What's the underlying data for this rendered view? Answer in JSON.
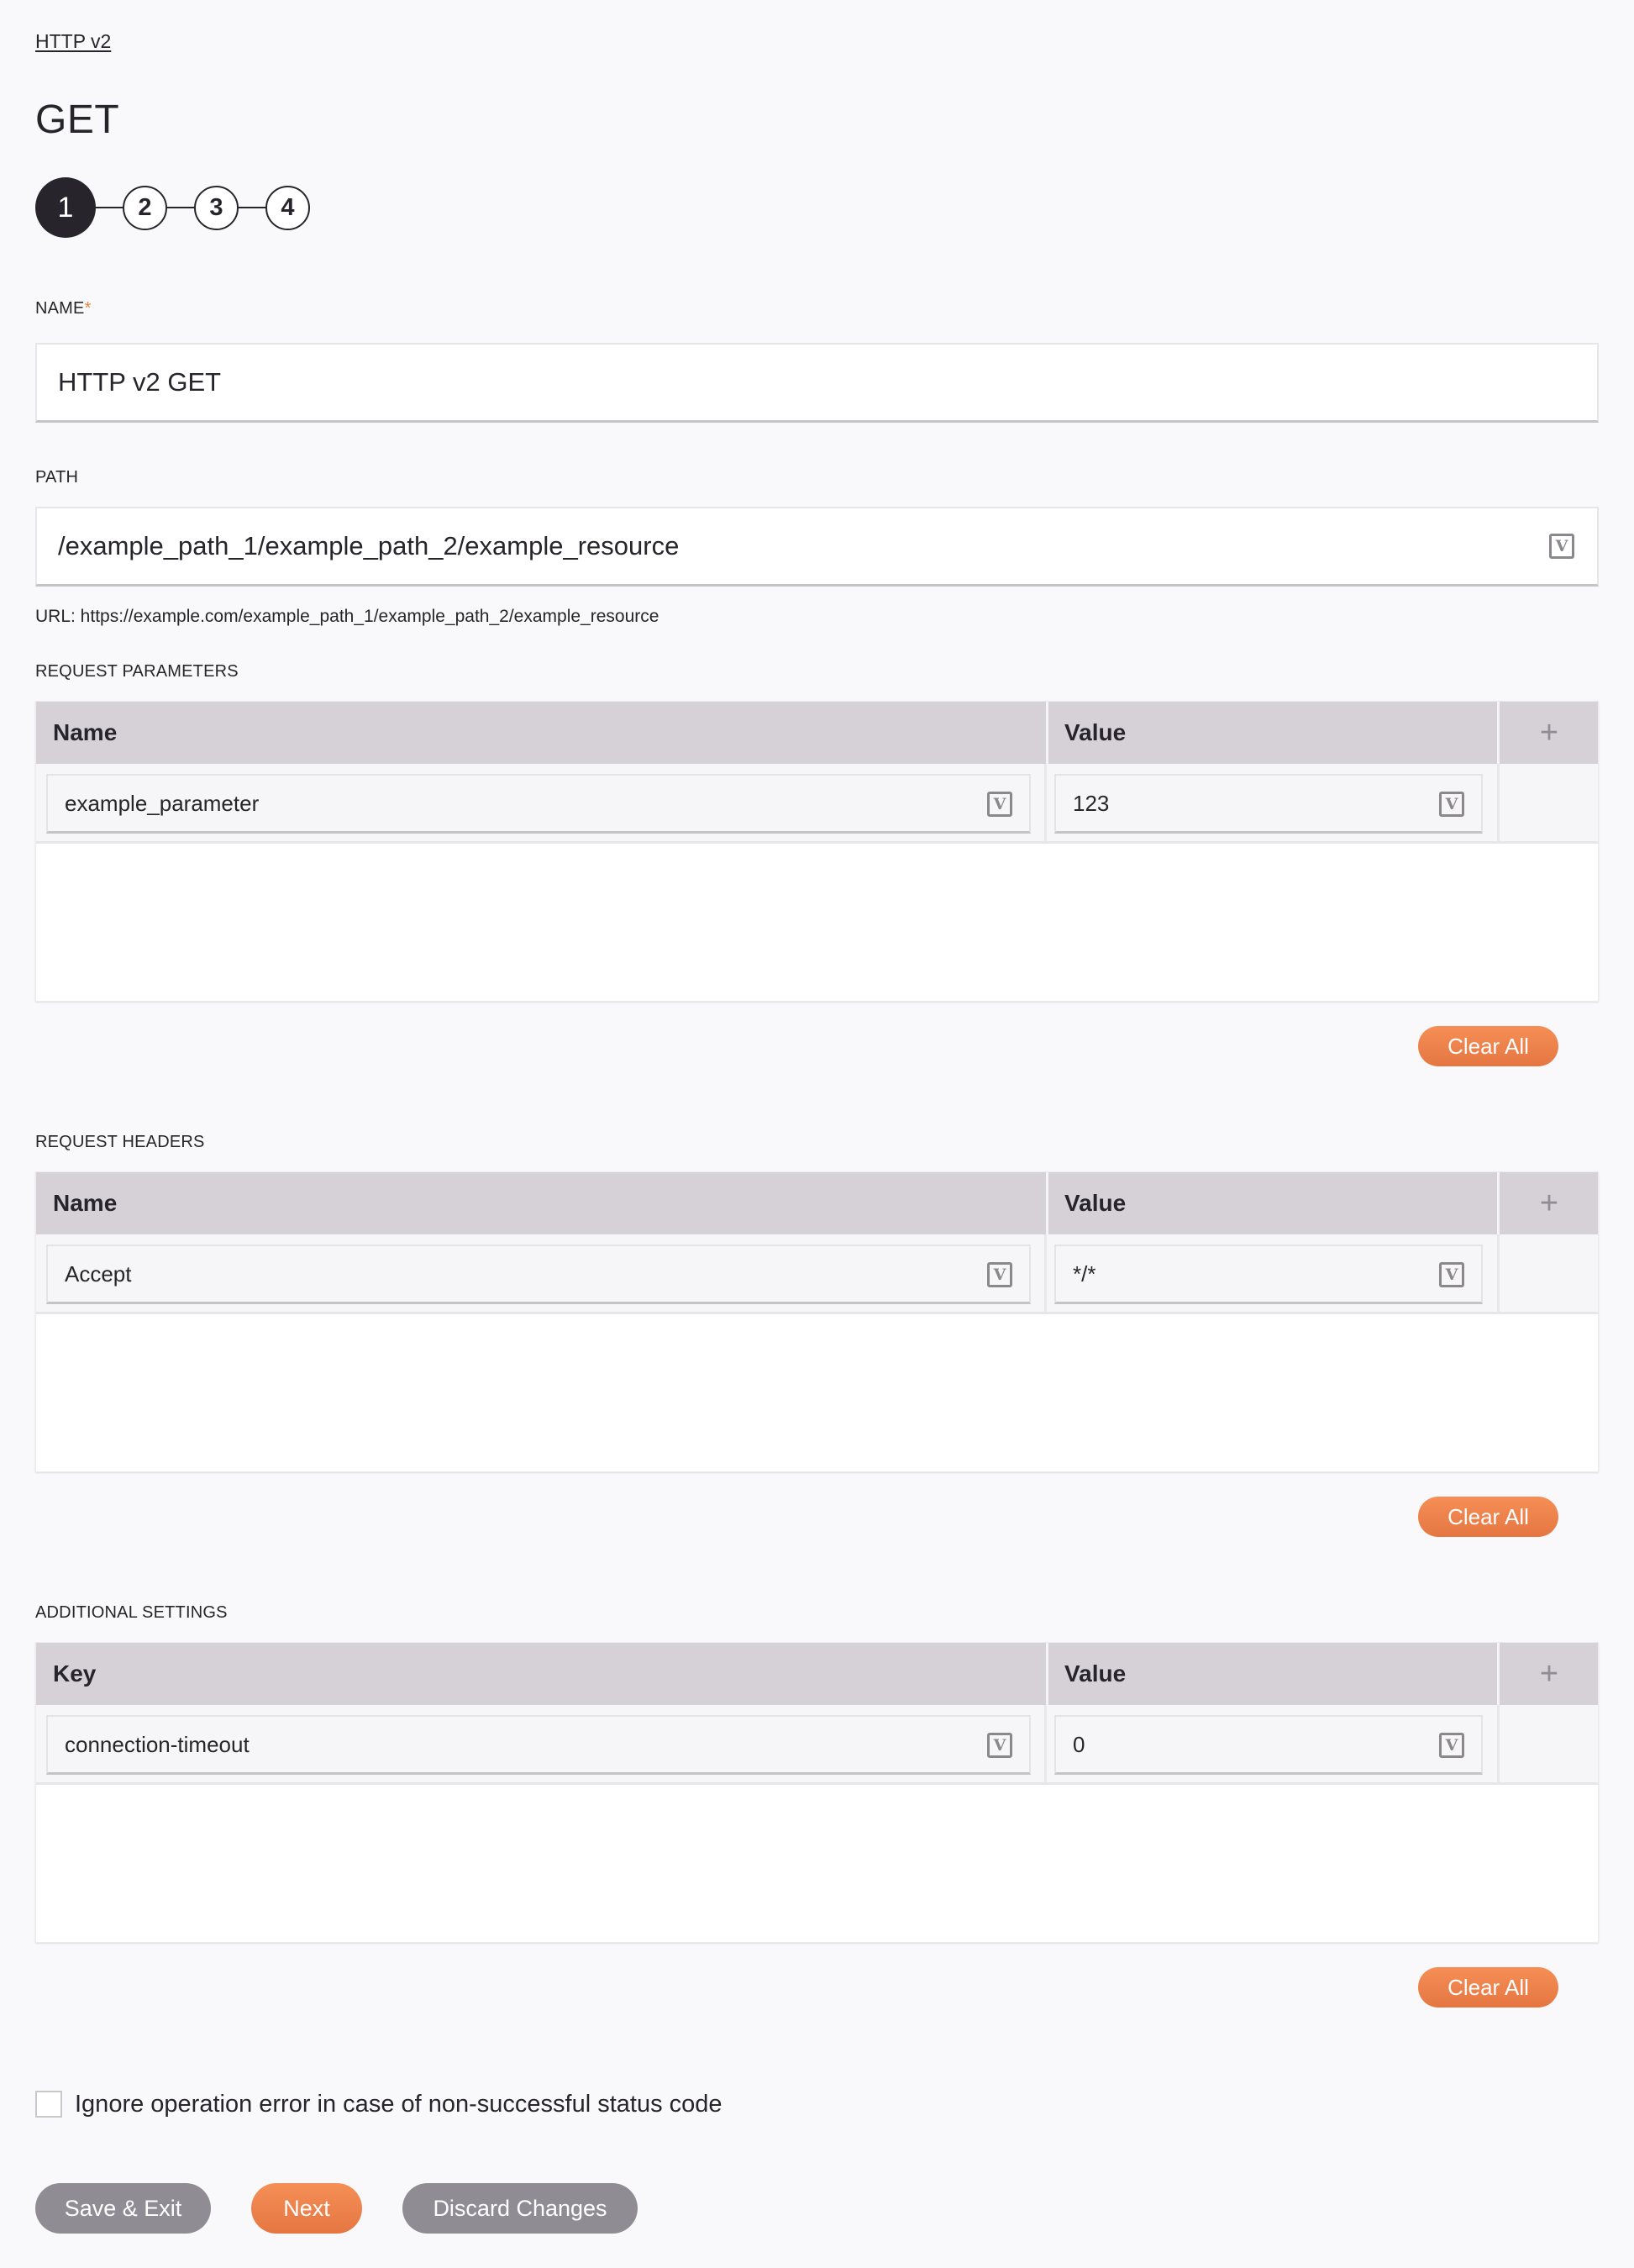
{
  "breadcrumb": "HTTP v2",
  "page_title": "GET",
  "stepper": {
    "steps": [
      "1",
      "2",
      "3",
      "4"
    ],
    "active_step": 1
  },
  "name_field": {
    "label": "NAME",
    "required_marker": "*",
    "value": "HTTP v2 GET"
  },
  "path_field": {
    "label": "PATH",
    "value": "/example_path_1/example_path_2/example_resource",
    "variable_icon": "V"
  },
  "url_text": "URL: https://example.com/example_path_1/example_path_2/example_resource",
  "request_parameters": {
    "label": "REQUEST PARAMETERS",
    "columns": [
      "Name",
      "Value"
    ],
    "add_icon": "+",
    "rows": [
      {
        "name": "example_parameter",
        "value": "123"
      }
    ],
    "clear_label": "Clear All"
  },
  "request_headers": {
    "label": "REQUEST HEADERS",
    "columns": [
      "Name",
      "Value"
    ],
    "add_icon": "+",
    "rows": [
      {
        "name": "Accept",
        "value": "*/*"
      }
    ],
    "clear_label": "Clear All"
  },
  "additional_settings": {
    "label": "ADDITIONAL SETTINGS",
    "columns": [
      "Key",
      "Value"
    ],
    "add_icon": "+",
    "rows": [
      {
        "name": "connection-timeout",
        "value": "0"
      }
    ],
    "clear_label": "Clear All"
  },
  "ignore_error_checkbox": {
    "label": "Ignore operation error in case of non-successful status code",
    "checked": false
  },
  "footer": {
    "save_exit_label": "Save & Exit",
    "next_label": "Next",
    "discard_label": "Discard Changes"
  },
  "variable_icon_glyph": "V",
  "colors": {
    "accent_orange": "#f08244",
    "secondary_gray": "#8f8c93",
    "header_bg": "#d6d1d7",
    "text": "#27252b"
  }
}
